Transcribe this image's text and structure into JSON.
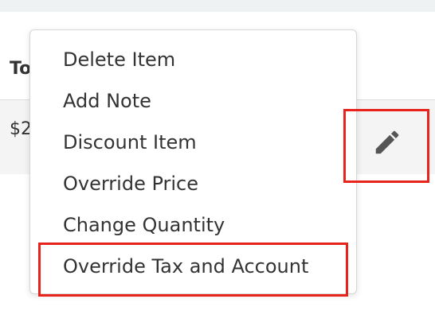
{
  "table": {
    "header_total": "To",
    "row_total": "$2"
  },
  "menu": {
    "items": [
      {
        "label": "Delete Item"
      },
      {
        "label": "Add Note"
      },
      {
        "label": "Discount Item"
      },
      {
        "label": "Override Price"
      },
      {
        "label": "Change Quantity"
      },
      {
        "label": "Override Tax and Account"
      }
    ]
  },
  "icons": {
    "edit": "pencil-icon"
  },
  "colors": {
    "highlight": "#e8231c",
    "row_background": "#f4f4f4",
    "top_bar": "#eef2f3",
    "icon": "#555555"
  }
}
